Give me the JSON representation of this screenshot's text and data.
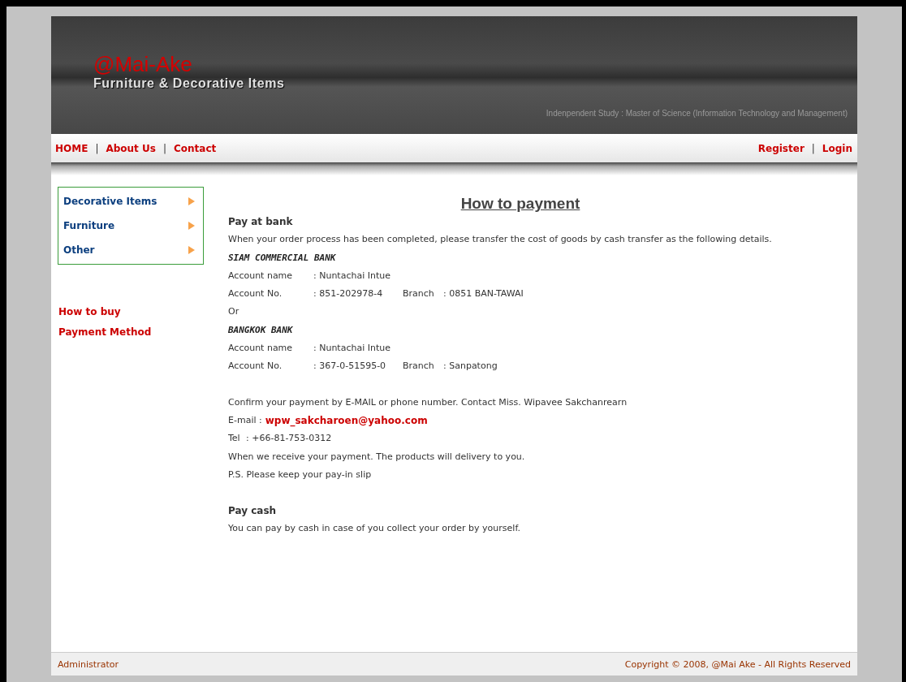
{
  "header": {
    "logo": "@Mai-Ake",
    "tagline": "Furniture & Decorative Items",
    "subtitle": "Indenpendent Study : Master of Science (Information Technology and Management)"
  },
  "nav": {
    "left": [
      {
        "kind": "link",
        "label": "HOME"
      },
      {
        "kind": "separator",
        "label": "|"
      },
      {
        "kind": "link",
        "label": "About Us"
      },
      {
        "kind": "separator",
        "label": "|"
      },
      {
        "kind": "link",
        "label": "Contact"
      }
    ],
    "right": [
      {
        "kind": "link",
        "label": "Register"
      },
      {
        "kind": "separator",
        "label": "|"
      },
      {
        "kind": "link",
        "label": "Login"
      }
    ]
  },
  "sidebar": {
    "categories": [
      {
        "label": "Decorative Items"
      },
      {
        "label": "Furniture"
      },
      {
        "label": "Other"
      }
    ],
    "links": [
      {
        "label": "How to buy"
      },
      {
        "label": "Payment Method"
      }
    ]
  },
  "content": {
    "title": "How to payment",
    "blocks": [
      {
        "kind": "heading",
        "text": "Pay at bank"
      },
      {
        "kind": "text",
        "text": "When your order process has been completed, please transfer the cost of goods by cash transfer as the following details."
      },
      {
        "kind": "bank",
        "text": "SIAM COMMERCIAL BANK"
      },
      {
        "kind": "field",
        "label": "Account name",
        "value": ": Nuntachai Intue"
      },
      {
        "kind": "account",
        "label": "Account No.",
        "value": ": 851-202978-4",
        "branch_label": "Branch",
        "branch_value": ": 0851 BAN-TAWAI"
      },
      {
        "kind": "text",
        "text": "Or"
      },
      {
        "kind": "bank",
        "text": "BANGKOK BANK"
      },
      {
        "kind": "field",
        "label": "Account name",
        "value": ": Nuntachai Intue"
      },
      {
        "kind": "account",
        "label": "Account No.",
        "value": ": 367-0-51595-0",
        "branch_label": "Branch",
        "branch_value": ": Sanpatong"
      },
      {
        "kind": "gap"
      },
      {
        "kind": "text",
        "text": "Confirm your payment by E-MAIL or phone number. Contact Miss. Wipavee Sakchanrearn"
      },
      {
        "kind": "email",
        "label": "E-mail :",
        "value": "wpw_sakcharoen@yahoo.com"
      },
      {
        "kind": "tel",
        "label": "Tel",
        "value": ": +66-81-753-0312"
      },
      {
        "kind": "text",
        "text": "When we receive your payment. The products will delivery to you."
      },
      {
        "kind": "text",
        "text": "P.S. Please keep your pay-in slip"
      },
      {
        "kind": "gap"
      },
      {
        "kind": "heading",
        "text": "Pay cash"
      },
      {
        "kind": "text",
        "text": "You can pay by cash in case of you collect your order by yourself."
      }
    ]
  },
  "footer": {
    "left": "Administrator",
    "right": "Copyright © 2008, @Mai Ake - All Rights Reserved"
  }
}
